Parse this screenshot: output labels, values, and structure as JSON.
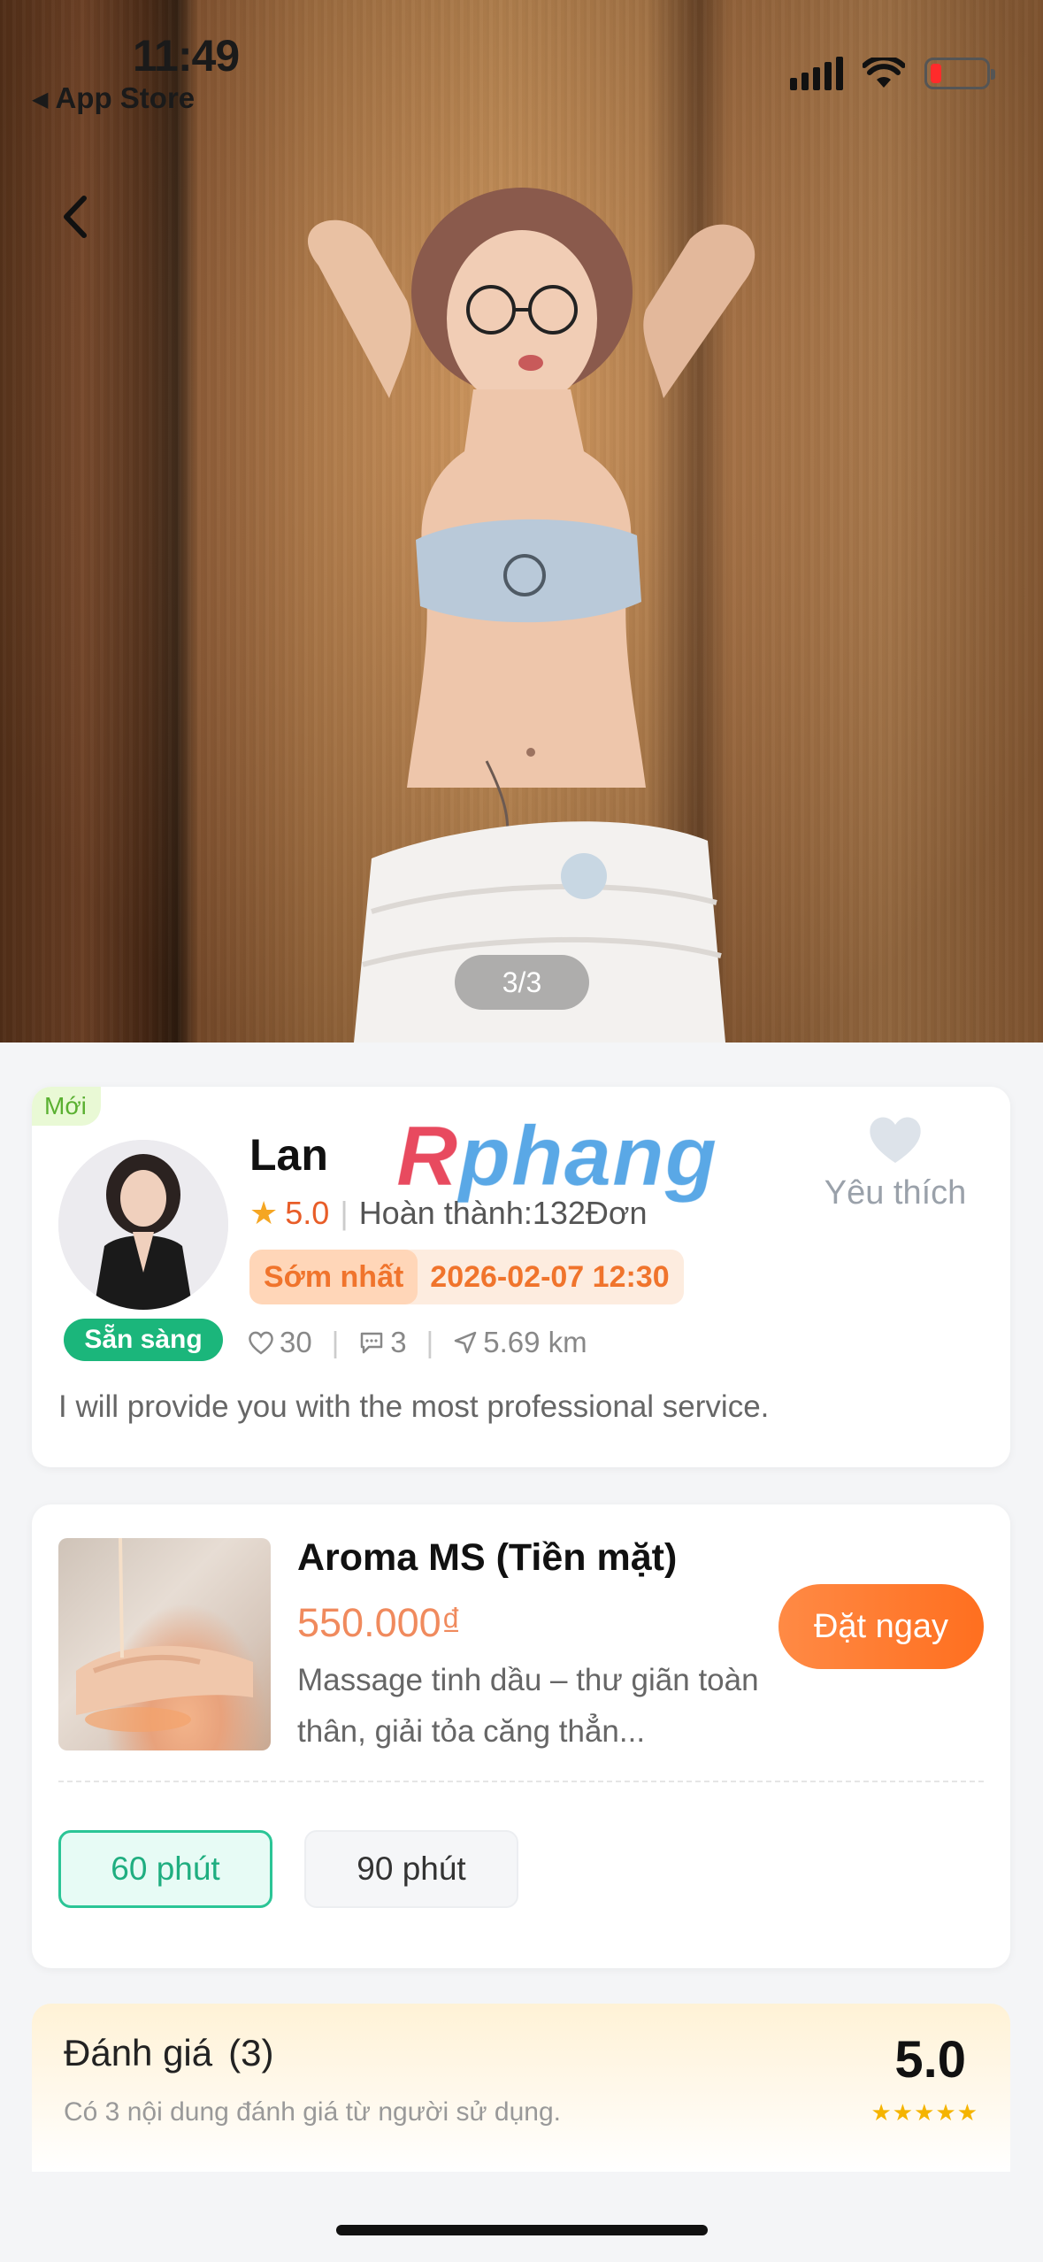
{
  "status_bar": {
    "time": "11:49",
    "back_app": "App Store",
    "icons": [
      "signal-icon",
      "wifi-icon",
      "battery-low-icon"
    ]
  },
  "gallery": {
    "counter": "3/3",
    "back_icon": "chevron-left-icon"
  },
  "profile": {
    "new_tag": "Mới",
    "name": "Lan",
    "brand_watermark": "Rphang",
    "rating": "5.0",
    "completed": "Hoàn thành:132Đơn",
    "earliest_label": "Sớm nhất",
    "earliest_datetime": "2026-02-07 12:30",
    "status": "Sẵn sàng",
    "likes": "30",
    "comments": "3",
    "distance": "5.69 km",
    "favorite_label": "Yêu thích",
    "bio": "I will provide you with the most professional service."
  },
  "service": {
    "title": "Aroma MS (Tiền mặt)",
    "price": "550.000₫",
    "description": "Massage tinh dầu – thư giãn toàn thân, giải tỏa căng thẳn...",
    "book_label": "Đặt ngay",
    "durations": [
      "60 phút",
      "90 phút"
    ],
    "selected_duration": "60 phút"
  },
  "reviews": {
    "title": "Đánh giá",
    "count": "(3)",
    "subtitle": "Có 3 nội dung đánh giá từ người sử dụng.",
    "score": "5.0",
    "stars": "★★★★★"
  },
  "colors": {
    "accent_orange": "#ff7a2f",
    "accent_green": "#1bb67b",
    "price_orange": "#f08a5d"
  }
}
